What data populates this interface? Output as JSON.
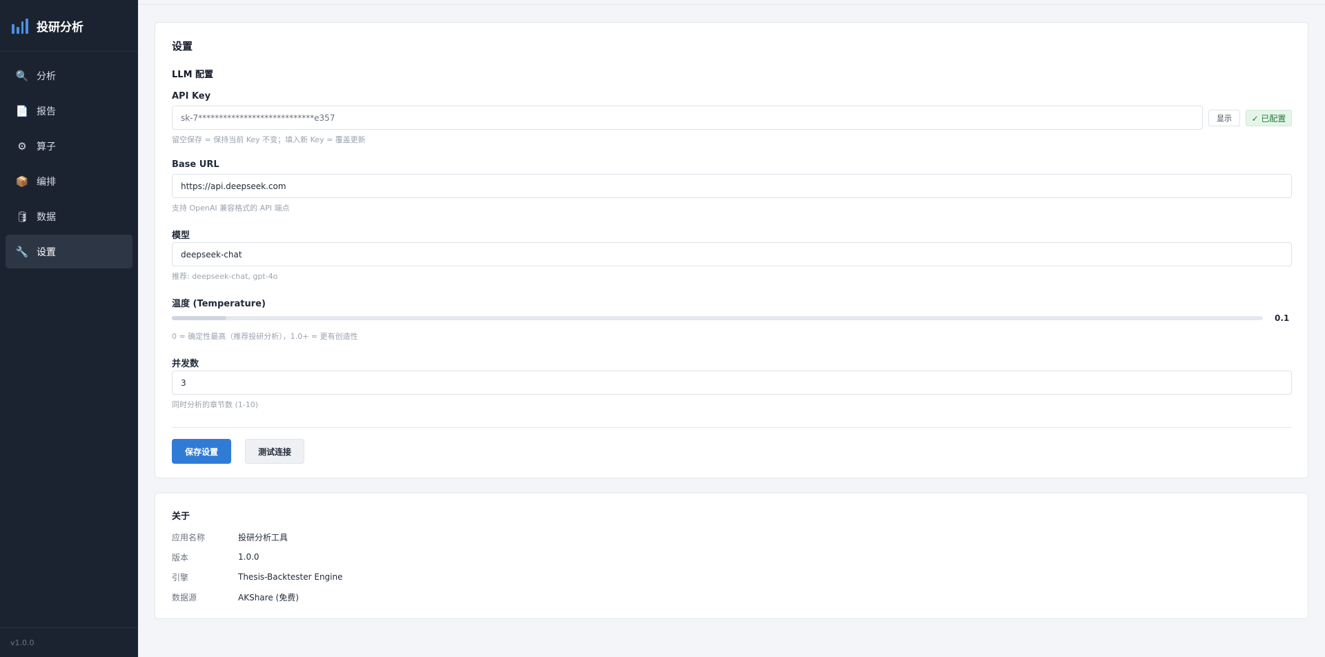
{
  "sidebar": {
    "brand": "投研分析",
    "items": [
      {
        "label": "分析",
        "icon": "🔍"
      },
      {
        "label": "报告",
        "icon": "📄"
      },
      {
        "label": "算子",
        "icon": "⚙"
      },
      {
        "label": "编排",
        "icon": "📦"
      },
      {
        "label": "数据",
        "icon": "🛢"
      },
      {
        "label": "设置",
        "icon": "🔧"
      }
    ],
    "active_item": "设置",
    "version": "v1.0.0"
  },
  "settings": {
    "title": "设置",
    "llm_section": "LLM 配置",
    "api_key": {
      "label": "API Key",
      "value": "sk-7****************************e357",
      "show_button": "显示",
      "status": "✓ 已配置",
      "hint": "留空保存 = 保持当前 Key 不变；填入新 Key = 覆盖更新"
    },
    "base_url": {
      "label": "Base URL",
      "value": "https://api.deepseek.com",
      "hint": "支持 OpenAI 兼容格式的 API 端点"
    },
    "model": {
      "label": "模型",
      "value": "deepseek-chat",
      "hint": "推荐: deepseek-chat, gpt-4o"
    },
    "temperature": {
      "label": "温度 (Temperature)",
      "value": "0.1",
      "fraction": 0.05,
      "hint": "0 = 确定性最高（推荐投研分析），1.0+ = 更有创造性"
    },
    "concurrency": {
      "label": "并发数",
      "value": "3",
      "hint": "同时分析的章节数 (1-10)"
    },
    "save_button": "保存设置",
    "test_button": "测试连接"
  },
  "about": {
    "title": "关于",
    "rows": [
      {
        "key": "应用名称",
        "value": "投研分析工具"
      },
      {
        "key": "版本",
        "value": "1.0.0"
      },
      {
        "key": "引擎",
        "value": "Thesis-Backtester Engine"
      },
      {
        "key": "数据源",
        "value": "AKShare (免费)"
      }
    ]
  }
}
